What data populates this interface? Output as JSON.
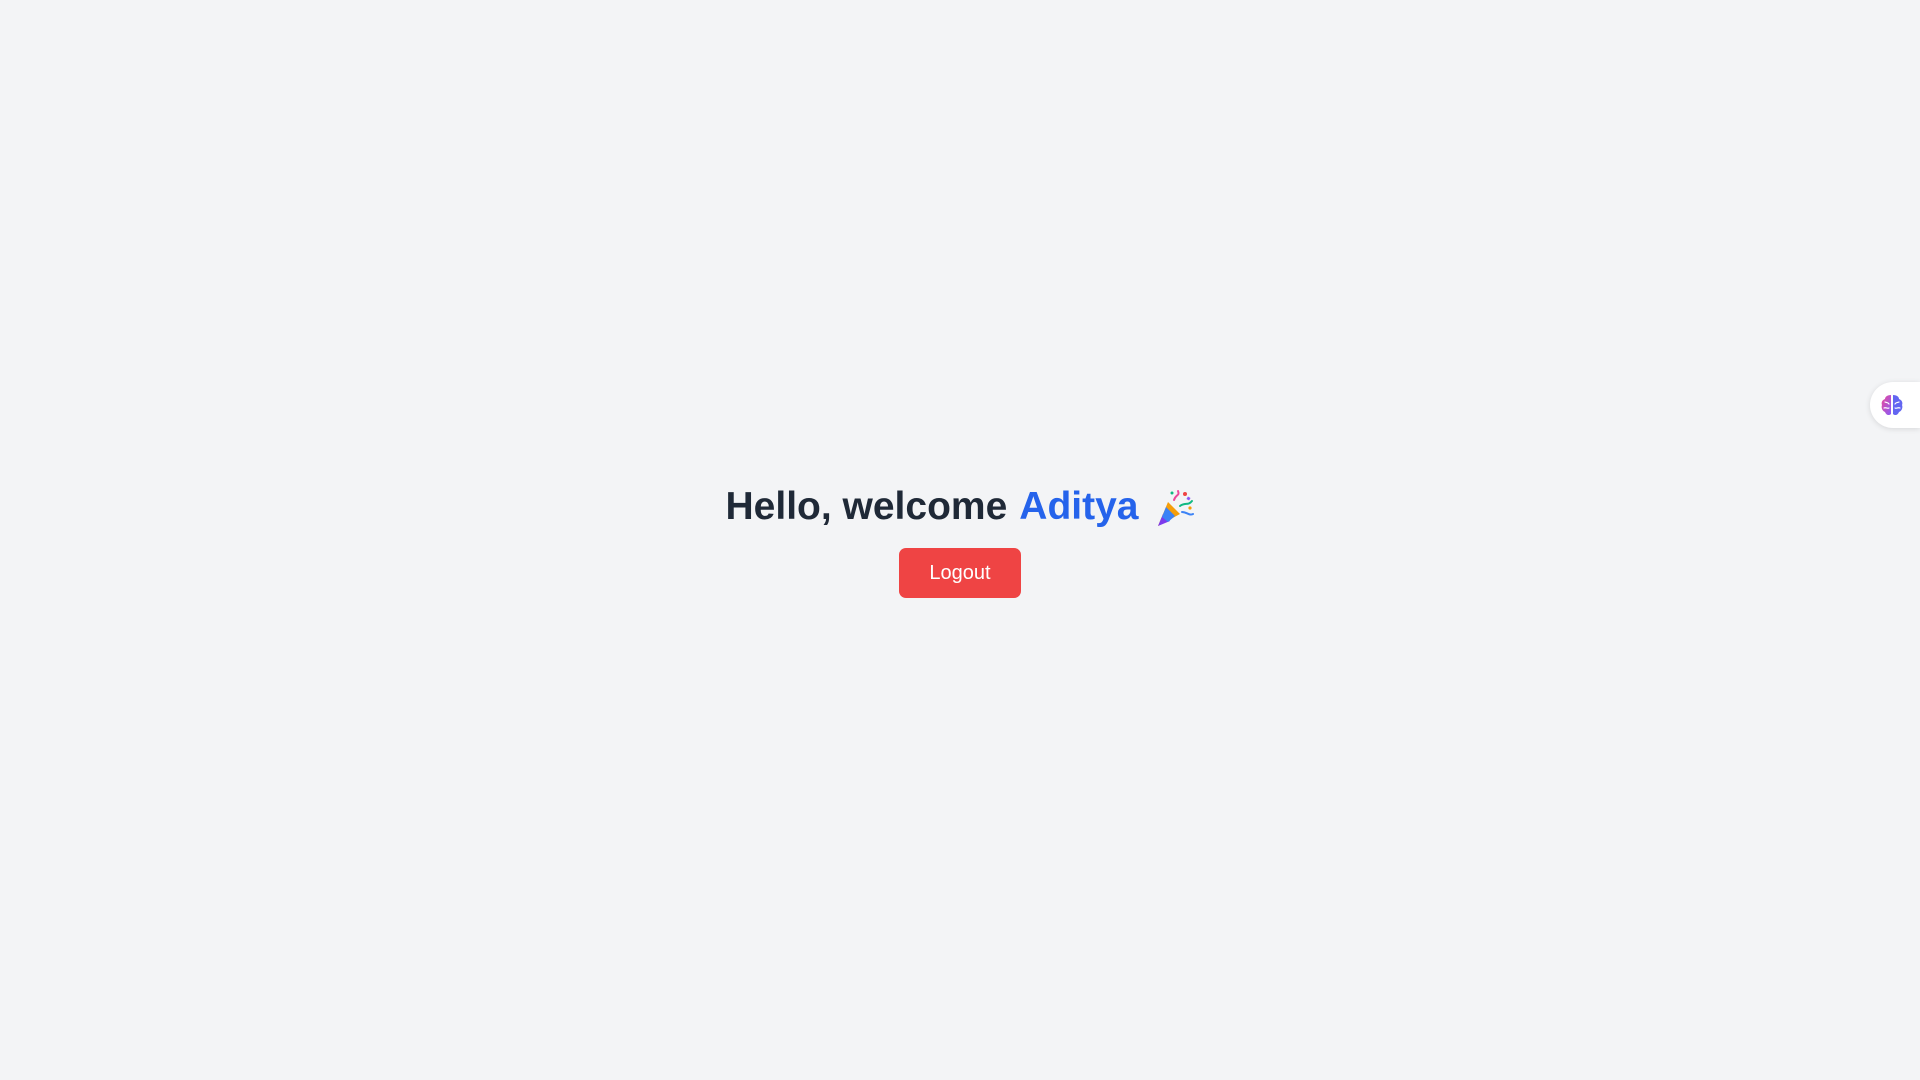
{
  "greeting": {
    "prefix": "Hello, welcome",
    "name": "Aditya",
    "emoji_icon": "party-popper-icon"
  },
  "actions": {
    "logout_label": "Logout"
  },
  "side_widget": {
    "icon": "brain-icon"
  },
  "colors": {
    "background": "#f3f4f6",
    "heading": "#1f2937",
    "name_accent": "#2563eb",
    "logout_button": "#ef4444"
  }
}
